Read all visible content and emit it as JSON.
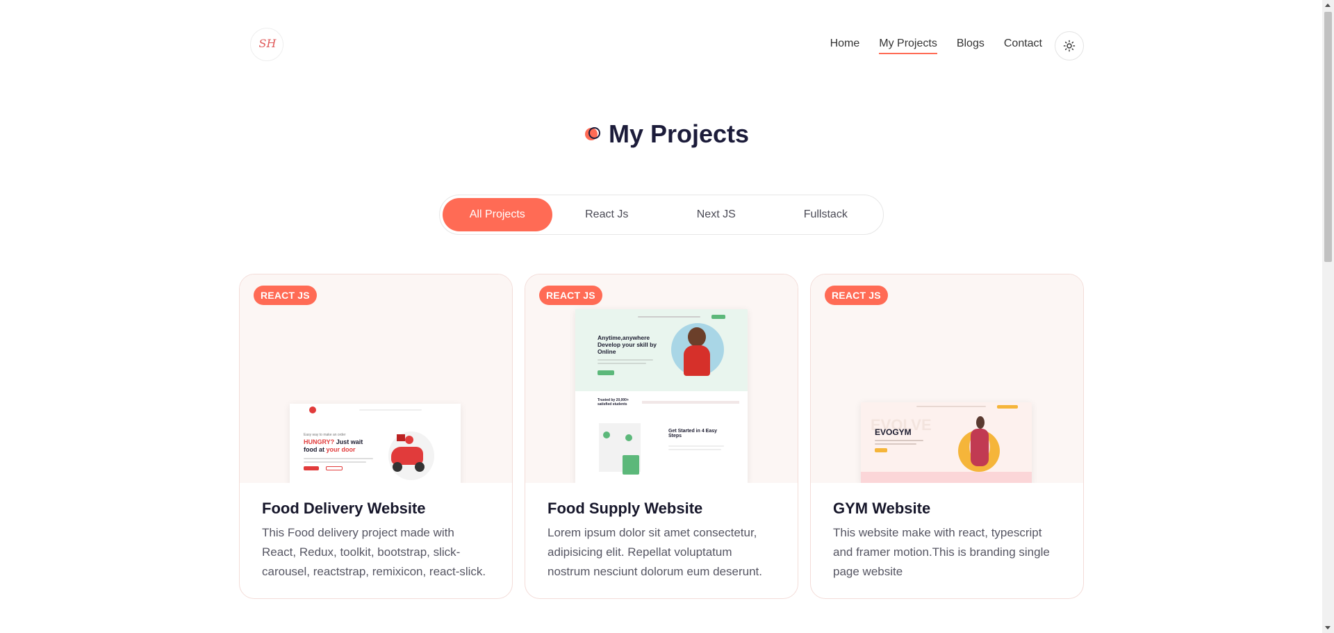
{
  "header": {
    "logo_text": "SH",
    "nav": [
      {
        "label": "Home",
        "active": false
      },
      {
        "label": "My Projects",
        "active": true
      },
      {
        "label": "Blogs",
        "active": false
      },
      {
        "label": "Contact",
        "active": false
      }
    ],
    "theme_icon": "sun-icon"
  },
  "page": {
    "title": "My Projects"
  },
  "tabs": [
    {
      "label": "All Projects",
      "active": true
    },
    {
      "label": "React Js",
      "active": false
    },
    {
      "label": "Next JS",
      "active": false
    },
    {
      "label": "Fullstack",
      "active": false
    }
  ],
  "projects": [
    {
      "badge": "REACT JS",
      "title": "Food Delivery Website",
      "description": "This Food delivery project made with React, Redux, toolkit, bootstrap, slick-carousel, reactstrap, remixicon, react-slick.",
      "preview": {
        "headline_a": "HUNGRY?",
        "headline_b": "Just wait",
        "headline_c": "food at",
        "headline_d": "your door",
        "pre": "Easy way to make an order"
      }
    },
    {
      "badge": "REACT JS",
      "title": "Food Supply Website",
      "description": "Lorem ipsum dolor sit amet consectetur, adipisicing elit. Repellat voluptatum nostrum nesciunt dolorum eum deserunt.",
      "preview": {
        "headline": "Anytime,anywhere Develop your skill by Online",
        "trusted": "Trusted by 20,000+ satisfied students",
        "steps": "Get Started in 4 Easy Steps"
      }
    },
    {
      "badge": "REACT JS",
      "title": "GYM Website",
      "description": "This website make with react, typescript and framer motion.This is branding single page website",
      "preview": {
        "brand": "EVOGYM",
        "watermark": "EVOLVE"
      }
    }
  ],
  "colors": {
    "accent": "#ff6b55",
    "text_dark": "#1c1c3a"
  }
}
